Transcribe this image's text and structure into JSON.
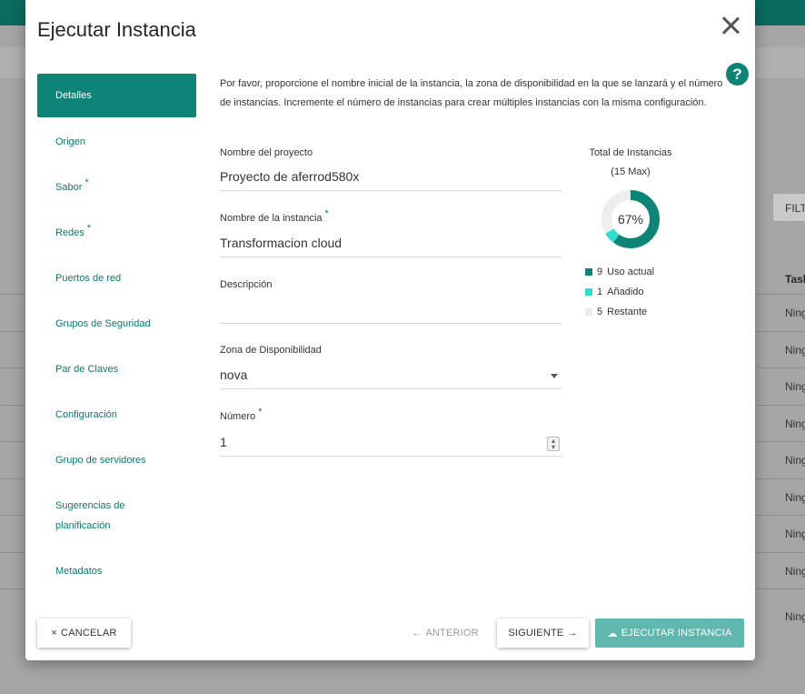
{
  "background": {
    "filter_label": "FILT",
    "column_header": "Task",
    "row_values": [
      "Ning",
      "Ning",
      "Ning",
      "Ning",
      "Ning",
      "Ning",
      "Ning",
      "Ning",
      "Ning"
    ]
  },
  "modal": {
    "title": "Ejecutar Instancia",
    "help_label": "?",
    "intro": "Por favor, proporcione el nombre inicial de la instancia, la zona de disponibilidad en la que se lanzará y el número de instancias. Incremente el número de instancias para crear múltiples instancias con la misma configuración."
  },
  "nav": {
    "items": [
      {
        "label": "Detalles",
        "active": true,
        "required": false
      },
      {
        "label": "Origen",
        "required": false
      },
      {
        "label": "Sabor",
        "required": true
      },
      {
        "label": "Redes",
        "required": true
      },
      {
        "label": "Puertos de red",
        "required": false
      },
      {
        "label": "Grupos de Seguridad",
        "required": false
      },
      {
        "label": "Par de Claves",
        "required": false
      },
      {
        "label": "Configuración",
        "required": false
      },
      {
        "label": "Grupo de servidores",
        "required": false
      },
      {
        "label": "Sugerencias de planificación",
        "required": false
      },
      {
        "label": "Metadatos",
        "required": false
      }
    ],
    "required_marker": "*"
  },
  "form": {
    "project": {
      "label": "Nombre del proyecto",
      "value": "Proyecto de aferrod580x"
    },
    "instance_name": {
      "label": "Nombre de la instancia",
      "value": "Transformacion cloud"
    },
    "description": {
      "label": "Descripción",
      "value": ""
    },
    "zone": {
      "label": "Zona de Disponibilidad",
      "value": "nova"
    },
    "number": {
      "label": "Número",
      "value": "1"
    },
    "required_marker": "*"
  },
  "chart_data": {
    "type": "pie",
    "title": "Total de Instancias",
    "subtitle": "(15 Max)",
    "center_label": "67%",
    "max": 15,
    "series": [
      {
        "name": "Uso actual",
        "value": 9,
        "color": "#0d8475"
      },
      {
        "name": "Añadido",
        "value": 1,
        "color": "#2de0cf"
      },
      {
        "name": "Restante",
        "value": 5,
        "color": "#eeeeee"
      }
    ]
  },
  "footer": {
    "cancel": "CANCELAR",
    "previous": "ANTERIOR",
    "next": "SIGUIENTE",
    "launch": "EJECUTAR INSTANCIA"
  },
  "icons": {
    "cancel": "×",
    "previous": "←",
    "next": "→",
    "launch": "☁"
  }
}
